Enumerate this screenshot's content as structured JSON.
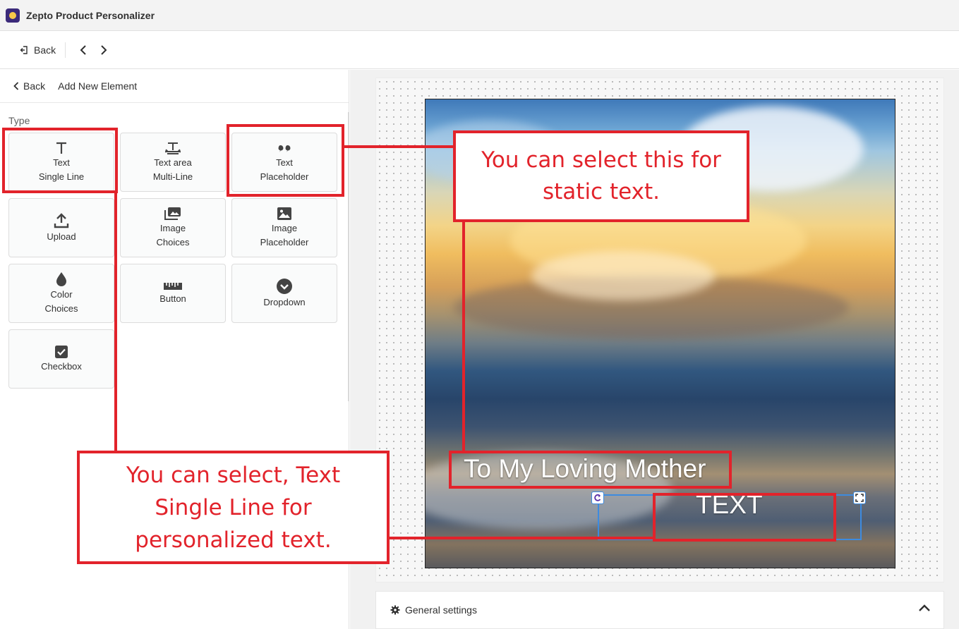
{
  "app": {
    "title": "Zepto Product Personalizer",
    "logo_icon": "zepto-logo-icon"
  },
  "navbar": {
    "back_label": "Back",
    "prev_icon": "chevron-left-icon",
    "next_icon": "chevron-right-icon"
  },
  "sidebar": {
    "back_label": "Back",
    "title": "Add New Element",
    "type_label": "Type",
    "elements": [
      {
        "line1": "Text",
        "line2": "Single Line",
        "icon": "text-icon"
      },
      {
        "line1": "Text area",
        "line2": "Multi-Line",
        "icon": "text-area-icon"
      },
      {
        "line1": "Text",
        "line2": "Placeholder",
        "icon": "quote-icon"
      },
      {
        "line1": "Upload",
        "line2": "",
        "icon": "upload-icon"
      },
      {
        "line1": "Image",
        "line2": "Choices",
        "icon": "images-icon"
      },
      {
        "line1": "Image",
        "line2": "Placeholder",
        "icon": "image-icon"
      },
      {
        "line1": "Color",
        "line2": "Choices",
        "icon": "drop-icon"
      },
      {
        "line1": "Button",
        "line2": "",
        "icon": "ruler-icon"
      },
      {
        "line1": "Dropdown",
        "line2": "",
        "icon": "chevron-circle-icon"
      },
      {
        "line1": "Checkbox",
        "line2": "",
        "icon": "checkbox-icon"
      }
    ]
  },
  "canvas": {
    "static_text": "To My Loving Mother",
    "field_text": "TEXT",
    "rotate_handle_icon": "rotate-icon",
    "resize_handle_icon": "fullscreen-icon"
  },
  "settings": {
    "label": "General settings",
    "icon": "gear-icon",
    "toggle_icon": "chevron-up-icon"
  },
  "annotations": {
    "static_callout": "You can select this for static text.",
    "single_line_callout": "You can select, Text Single Line for personalized text.",
    "color": "#e2232b"
  }
}
